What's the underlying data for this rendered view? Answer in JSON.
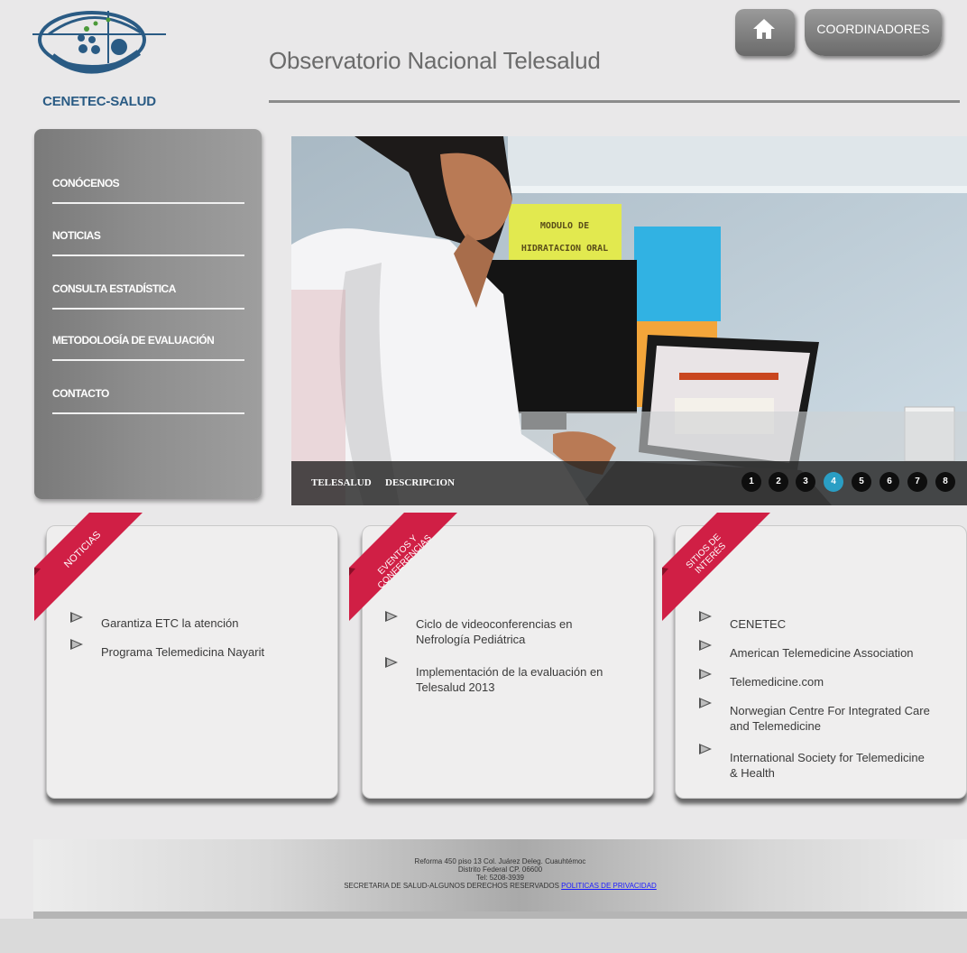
{
  "header": {
    "logo_text": "CENETEC-SALUD",
    "title": "Observatorio Nacional Telesalud",
    "coordinators_label": "COORDINADORES"
  },
  "nav": {
    "items": [
      {
        "label": "CONÓCENOS"
      },
      {
        "label": "NOTICIAS"
      },
      {
        "label": "CONSULTA ESTADÍSTICA"
      },
      {
        "label": "METODOLOGÍA DE EVALUACIÓN"
      },
      {
        "label": "CONTACTO"
      }
    ]
  },
  "hero": {
    "caption_left": "TELESALUD",
    "caption_right": "DESCRIPCION",
    "slides": [
      "1",
      "2",
      "3",
      "4",
      "5",
      "6",
      "7",
      "8"
    ],
    "active_slide": "4",
    "poster_text": "MODULO DE HIDRATACION ORAL"
  },
  "boxes": {
    "noticias": {
      "ribbon": "NOTICIAS",
      "items": [
        "Garantiza ETC la atención",
        "Programa Telemedicina Nayarit"
      ]
    },
    "eventos": {
      "ribbon_line1": "EVENTOS Y",
      "ribbon_line2": "CONFERENCIAS",
      "items": [
        {
          "line1": "Ciclo de videoconferencias en",
          "line2": "Nefrología Pediátrica"
        },
        {
          "line1": "Implementación de la evaluación en",
          "line2": "Telesalud 2013"
        }
      ]
    },
    "sitios": {
      "ribbon_line1": "SITIOS DE",
      "ribbon_line2": "INTERÉS",
      "items": [
        {
          "line1": "CENETEC",
          "line2": ""
        },
        {
          "line1": "American Telemedicine Association",
          "line2": ""
        },
        {
          "line1": "Telemedicine.com",
          "line2": ""
        },
        {
          "line1": "Norwegian Centre For Integrated Care",
          "line2": "and Telemedicine"
        },
        {
          "line1": "International Society for Telemedicine",
          "line2": "& Health"
        }
      ]
    }
  },
  "footer": {
    "line1": "Reforma 450 piso 13 Col. Juárez Deleg. Cuauhtémoc",
    "line2": "Distrito Federal CP. 06600",
    "line3": "Tel: 5208-3939",
    "line4": "SECRETARIA DE SALUD-ALGUNOS DERECHOS RESERVADOS",
    "privacy_link": "POLITICAS DE PRIVACIDAD"
  },
  "colors": {
    "ribbon": "#d01f45",
    "active_dot": "#2a9ec4",
    "logo_blue": "#2a5b84"
  }
}
